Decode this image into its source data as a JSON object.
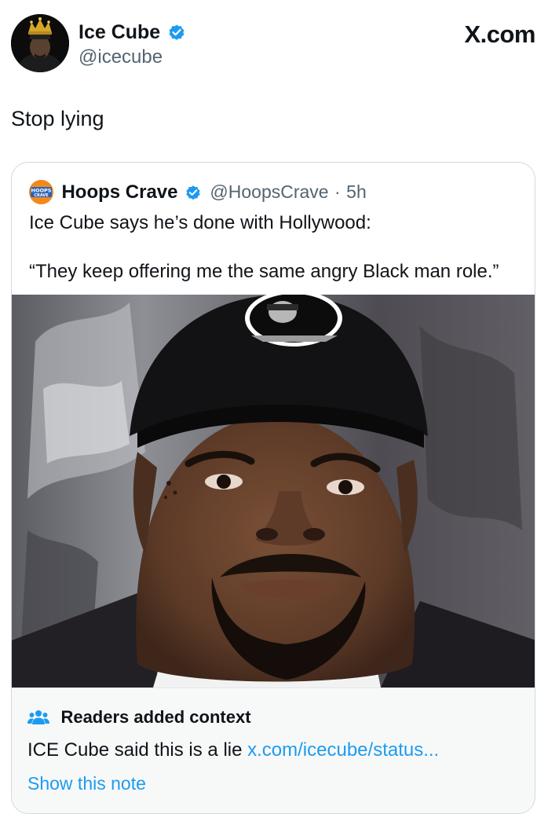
{
  "post": {
    "author": {
      "display_name": "Ice Cube",
      "handle": "@icecube",
      "verified_icon": "verified-badge-icon"
    },
    "site_label": "X.com",
    "text": "Stop lying"
  },
  "quoted_post": {
    "author": {
      "display_name": "Hoops Crave",
      "handle": "@HoopsCrave",
      "verified_icon": "verified-badge-icon",
      "avatar_text_top": "HOOPS",
      "avatar_text_bottom": "CRAVE"
    },
    "separator": "·",
    "time": "5h",
    "text_line_1": "Ice Cube says he’s done with Hollywood:",
    "text_line_2": "“They keep offering me the same angry Black man role.”",
    "media": "portrait photo of a man in a black cap"
  },
  "community_note": {
    "icon": "people-icon",
    "title": "Readers added context",
    "body_text": "ICE Cube said this is a lie ",
    "link_text": "x.com/icecube/status...",
    "show_note_label": "Show this note"
  },
  "colors": {
    "accent": "#1d9bf0",
    "secondary_text": "#536471",
    "border": "#cfd9de",
    "note_bg": "#f7f9f9"
  }
}
